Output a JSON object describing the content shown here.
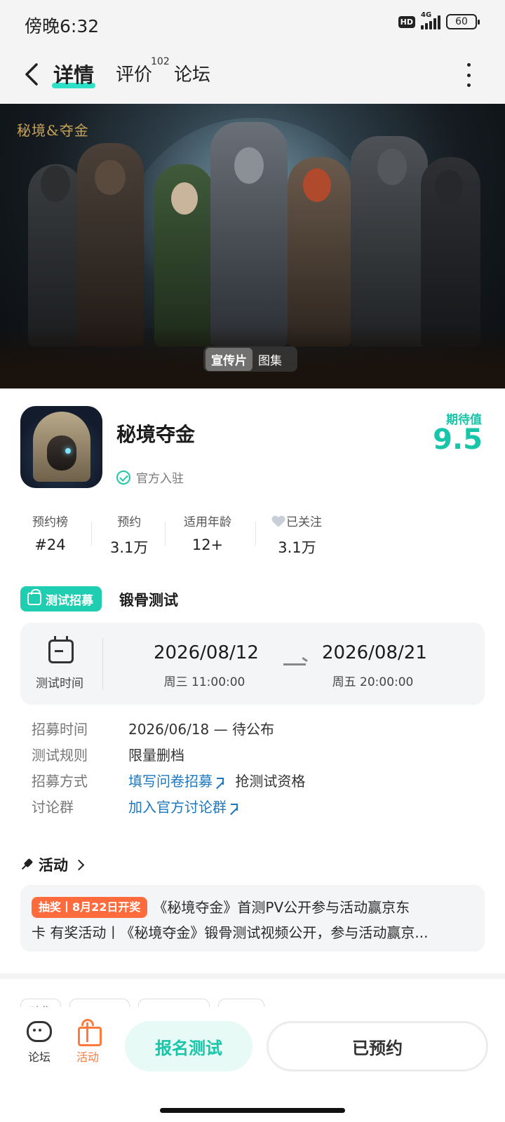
{
  "status_bar": {
    "time": "傍晚6:32",
    "hd": "HD",
    "network": "4G",
    "battery": "60"
  },
  "nav": {
    "tabs": [
      {
        "label": "详情",
        "active": true
      },
      {
        "label": "评价",
        "badge": "102"
      },
      {
        "label": "论坛"
      }
    ]
  },
  "banner": {
    "logo_text": "秘境&夺金",
    "tabs": [
      "宣传片",
      "图集"
    ],
    "active_tab": "宣传片"
  },
  "game": {
    "title": "秘境夺金",
    "official": "官方入驻",
    "expect_label": "期待值",
    "expect_score": "9.5"
  },
  "stats": [
    {
      "label": "预约榜",
      "value": "#24"
    },
    {
      "label": "预约",
      "value": "3.1万"
    },
    {
      "label": "适用年龄",
      "value": "12+"
    },
    {
      "label": "已关注",
      "value": "3.1万"
    }
  ],
  "test": {
    "tag": "测试招募",
    "name": "锻骨测试",
    "time_label": "测试时间",
    "start": {
      "date": "2026/08/12",
      "weekday": "周三",
      "time": "11:00:00"
    },
    "end": {
      "date": "2026/08/21",
      "weekday": "周五",
      "time": "20:00:00"
    },
    "rows": [
      {
        "key": "招募时间",
        "value": "2026/06/18 — 待公布"
      },
      {
        "key": "测试规则",
        "value": "限量删档"
      },
      {
        "key": "招募方式",
        "link": "填写问卷招募",
        "extra": "抢测试资格"
      },
      {
        "key": "讨论群",
        "link": "加入官方讨论群"
      }
    ]
  },
  "activity": {
    "title": "活动",
    "tag": "抽奖丨8月22日开奖",
    "line1": "《秘境夺金》首测PV公开参与活动赢京东",
    "line2": "卡 有奖活动丨《秘境夺金》锻骨测试视频公开，参与活动赢京..."
  },
  "chips": [
    "动作",
    "",
    "",
    ""
  ],
  "bottom_bar": {
    "forum": "论坛",
    "activity": "活动",
    "signup": "报名测试",
    "reserved": "已预约"
  },
  "colors": {
    "accent": "#17c6a8",
    "orange": "#ff6b3d",
    "link": "#1d78bf"
  }
}
